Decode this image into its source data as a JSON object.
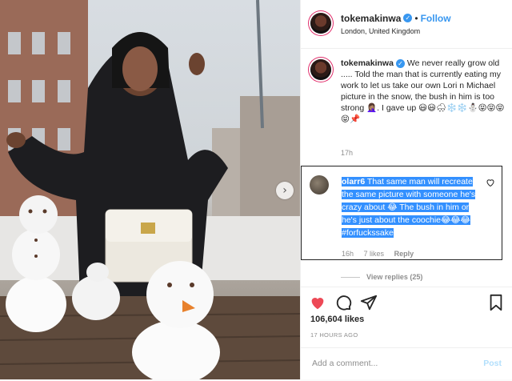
{
  "post": {
    "username": "tokemakinwa",
    "follow_label": "Follow",
    "location": "London, United Kingdom",
    "caption_text": "We never really grow old ..... Told the man that is currently eating my work to let us take our own Lori n Michael picture in the snow, the bush in him is too strong 🤦🏽‍♀️. I gave up 😃😃🌨❄️❄️⛄️😝😝😝😝📌",
    "caption_time": "17h",
    "likes": "106,604 likes",
    "posted": "17 HOURS AGO",
    "view_replies": "View replies (25)"
  },
  "reply": {
    "username": "olarr6",
    "text": "That same man will recreate the same picture with someone he's crazy about 😂 The bush in him or he's just about the coochie😂😂😂 #forfuckssake",
    "time": "16h",
    "likes": "7 likes",
    "reply_label": "Reply"
  },
  "comment_box": {
    "placeholder": "Add a comment...",
    "post_label": "Post"
  },
  "icons": {
    "verified": "verified-badge-icon",
    "like": "heart-icon",
    "comment": "speech-bubble-icon",
    "share": "paper-plane-icon",
    "save": "bookmark-icon",
    "carousel": "chevron-right-icon"
  },
  "colors": {
    "accent": "#3897f0",
    "like_red": "#ed4956",
    "highlight": "#3390ff"
  }
}
